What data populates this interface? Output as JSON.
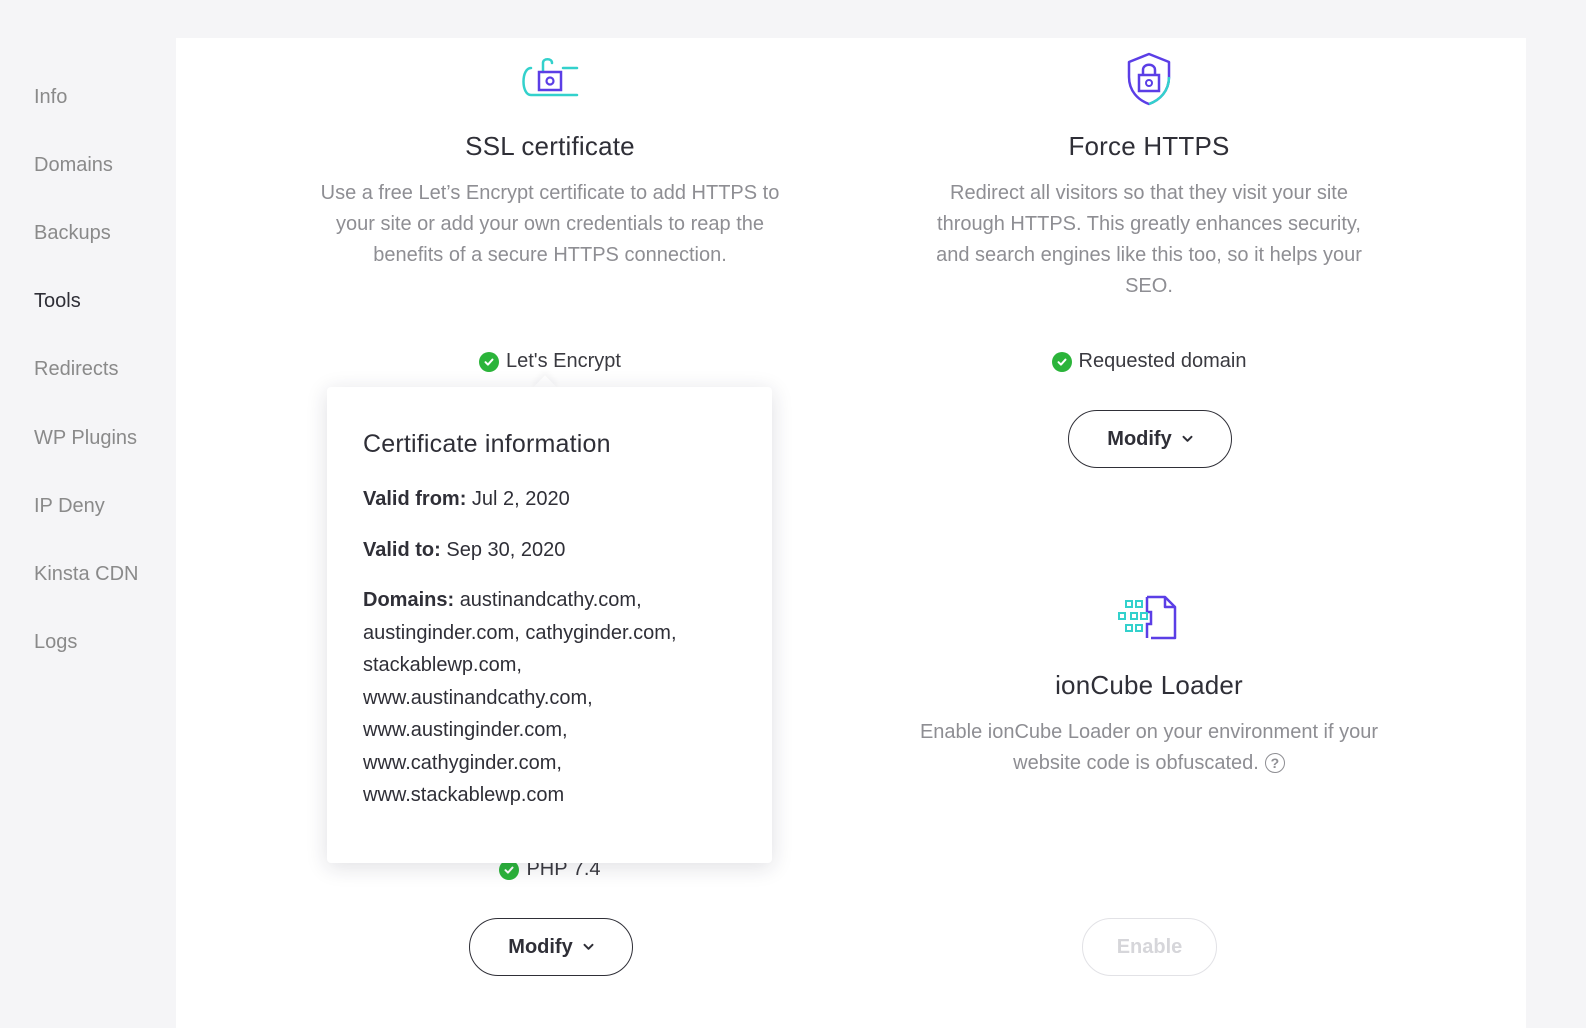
{
  "sidebar": {
    "items": [
      {
        "label": "Info"
      },
      {
        "label": "Domains"
      },
      {
        "label": "Backups"
      },
      {
        "label": "Tools"
      },
      {
        "label": "Redirects"
      },
      {
        "label": "WP Plugins"
      },
      {
        "label": "IP Deny"
      },
      {
        "label": "Kinsta CDN"
      },
      {
        "label": "Logs"
      }
    ],
    "active": "Tools"
  },
  "ssl": {
    "icon": "open-lock-icon",
    "title": "SSL certificate",
    "description": "Use a free Let’s Encrypt certificate to add HTTPS to your site or add your own credentials to reap the benefits of a secure HTTPS connection.",
    "status": "Let's Encrypt"
  },
  "force_https": {
    "icon": "shield-lock-icon",
    "title": "Force HTTPS",
    "description": "Redirect all visitors so that they visit your site through HTTPS. This greatly enhances security, and search engines like this too, so it helps your SEO.",
    "status": "Requested domain",
    "button": "Modify"
  },
  "php": {
    "status": "PHP 7.4",
    "button": "Modify"
  },
  "ioncube": {
    "icon": "ioncube-file-icon",
    "title": "ionCube Loader",
    "description": "Enable ionCube Loader on your environment if your website code is obfuscated.",
    "button": "Enable"
  },
  "cert_popover": {
    "title": "Certificate information",
    "valid_from_label": "Valid from:",
    "valid_from": "Jul 2, 2020",
    "valid_to_label": "Valid to:",
    "valid_to": "Sep 30, 2020",
    "domains_label": "Domains:",
    "domains": "austinandcathy.com, austinginder.com, cathyginder.com, stackablewp.com, www.austinandcathy.com, www.austinginder.com, www.cathyginder.com, www.stackablewp.com"
  },
  "colors": {
    "accent_purple": "#5b3ee6",
    "accent_teal": "#33d1cc",
    "success": "#2bb43a",
    "text_dark": "#2f2f37",
    "text_muted": "#8e8e93"
  }
}
